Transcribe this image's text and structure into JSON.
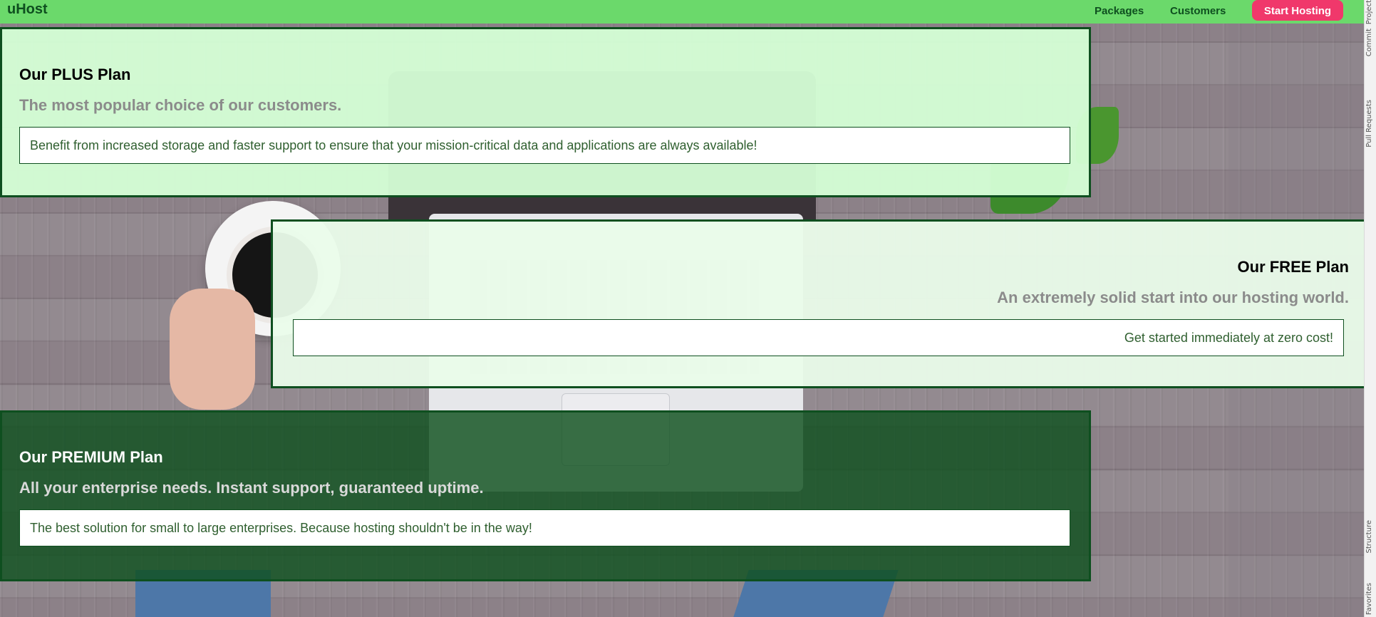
{
  "header": {
    "brand": "uHost",
    "nav": {
      "packages": "Packages",
      "customers": "Customers"
    },
    "cta": "Start Hosting"
  },
  "plans": {
    "plus": {
      "title": "Our PLUS Plan",
      "subtitle": "The most popular choice of our customers.",
      "description": "Benefit from increased storage and faster support to ensure that your mission-critical data and applications are always available!"
    },
    "free": {
      "title": "Our FREE Plan",
      "subtitle": "An extremely solid start into our hosting world.",
      "description": "Get started immediately at zero cost!"
    },
    "premium": {
      "title": "Our PREMIUM Plan",
      "subtitle": "All your enterprise needs. Instant support, guaranteed uptime.",
      "description": "The best solution for small to large enterprises. Because hosting shouldn't be in the way!"
    }
  },
  "ide_sidebar": {
    "project": "Project",
    "commit": "Commit",
    "pull_requests": "Pull Requests",
    "structure": "Structure",
    "favorites": "Favorites"
  },
  "colors": {
    "header_bg": "#6bd96b",
    "brand_text": "#0e4f1f",
    "cta_bg": "#f0386b",
    "plus_bg": "#d5ffd6",
    "premium_bg": "#0f501e"
  }
}
